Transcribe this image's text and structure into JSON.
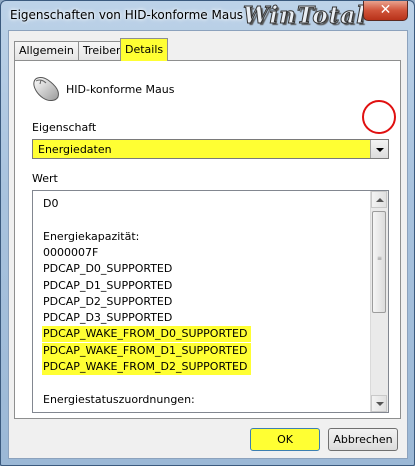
{
  "window": {
    "title": "Eigenschaften von HID-konforme Maus",
    "brand": "WinTotal",
    "close_glyph": "✕"
  },
  "tabs": [
    {
      "label": "Allgemein",
      "active": false
    },
    {
      "label": "Treiber",
      "active": false
    },
    {
      "label": "Details",
      "active": true
    }
  ],
  "device": {
    "icon": "mouse-icon",
    "name": "HID-konforme Maus"
  },
  "property": {
    "label": "Eigenschaft",
    "selected": "Energiedaten"
  },
  "values": {
    "label": "Wert",
    "lines": [
      "D0",
      "",
      "Energiekapazität:",
      "0000007F",
      "PDCAP_D0_SUPPORTED",
      "PDCAP_D1_SUPPORTED",
      "PDCAP_D2_SUPPORTED",
      "PDCAP_D3_SUPPORTED",
      "PDCAP_WAKE_FROM_D0_SUPPORTED",
      "PDCAP_WAKE_FROM_D1_SUPPORTED",
      "PDCAP_WAKE_FROM_D2_SUPPORTED",
      "",
      "Energiestatuszuordnungen:"
    ],
    "highlighted": [
      8,
      9,
      10
    ]
  },
  "buttons": {
    "ok": "OK",
    "cancel": "Abbrechen"
  },
  "colors": {
    "highlight": "#ffff33",
    "annotation": "#e01010"
  }
}
